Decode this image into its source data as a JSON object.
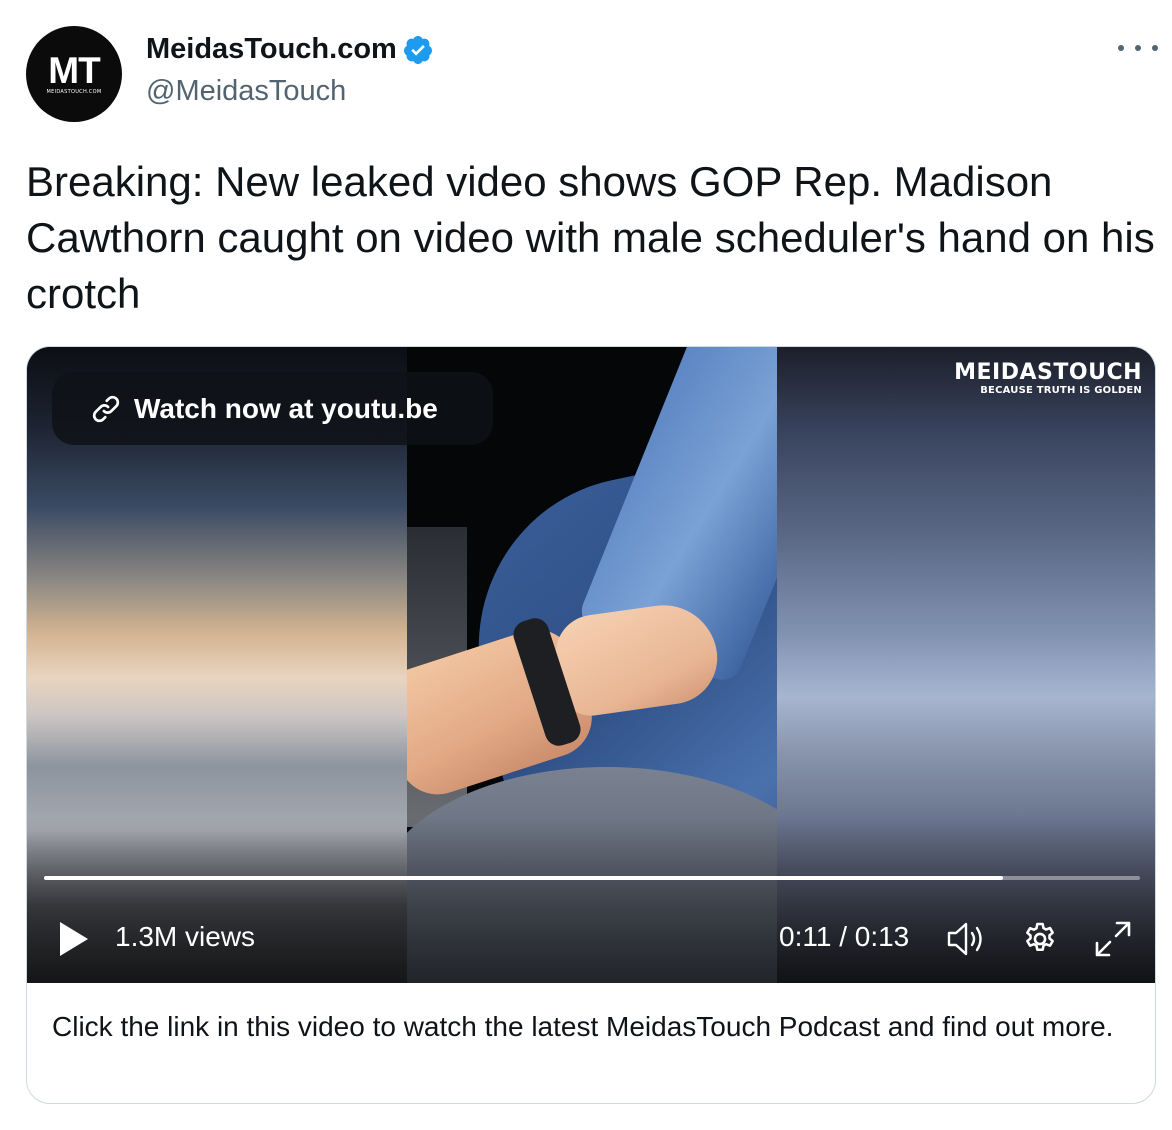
{
  "author": {
    "avatar_initials": "MT",
    "avatar_subtext": "MEIDASTOUCH.COM",
    "display_name": "MeidasTouch.com",
    "handle": "@MeidasTouch",
    "verified": true,
    "verified_color": "#1d9bf0"
  },
  "more_icon": "more-horizontal-icon",
  "tweet": {
    "text": "Breaking: New leaked video shows GOP Rep. Madison Cawthorn caught on video with male scheduler's hand on his crotch"
  },
  "video": {
    "watch_label": "Watch now at youtu.be",
    "watermark_name": "MeidasTouch",
    "watermark_tagline": "BECAUSE TRUTH IS GOLDEN",
    "progress_fraction": 0.875,
    "views": "1.3M views",
    "time": "0:11 / 0:13",
    "controls": {
      "play_icon": "play-icon",
      "volume_icon": "volume-icon",
      "settings_icon": "gear-icon",
      "fullscreen_icon": "fullscreen-icon"
    }
  },
  "card": {
    "description": "Click the link in this video to watch the latest MeidasTouch Podcast and find out more."
  }
}
